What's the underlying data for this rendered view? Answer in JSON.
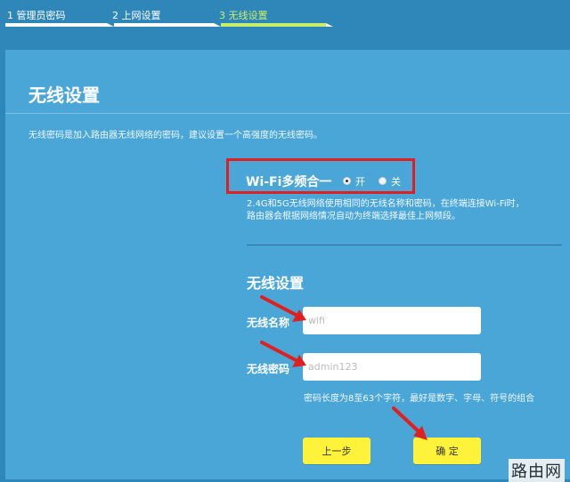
{
  "steps": [
    {
      "label": "1 管理员密码",
      "state": "done"
    },
    {
      "label": "2 上网设置",
      "state": "done"
    },
    {
      "label": "3 无线设置",
      "state": "active"
    }
  ],
  "colors": {
    "step_done": "#ffffff",
    "step_active": "#c8ef6a",
    "page_bg": "#2f86b9",
    "panel_bg": "#4aa6d6",
    "highlight": "#e02020",
    "button": "#fff23a"
  },
  "page": {
    "title": "无线设置",
    "description": "无线密码是加入路由器无线网络的密码，建议设置一个高强度的无线密码。"
  },
  "wifi_merge": {
    "label": "Wi-Fi多频合一",
    "options": [
      {
        "label": "开",
        "selected": true
      },
      {
        "label": "关",
        "selected": false
      }
    ],
    "note_line1": "2.4G和5G无线网络使用相同的无线名称和密码，在终端连接Wi-Fi时，",
    "note_line2": "路由器会根据网络情况自动为终端选择最佳上网频段。"
  },
  "wireless": {
    "section_title": "无线设置",
    "name_label": "无线名称",
    "name_value": "wifi",
    "password_label": "无线密码",
    "password_value": "admin123",
    "password_hint": "密码长度为8至63个字符，最好是数字、字母、符号的组合"
  },
  "buttons": {
    "prev": "上一步",
    "confirm": "确 定"
  },
  "watermark": "路由网"
}
